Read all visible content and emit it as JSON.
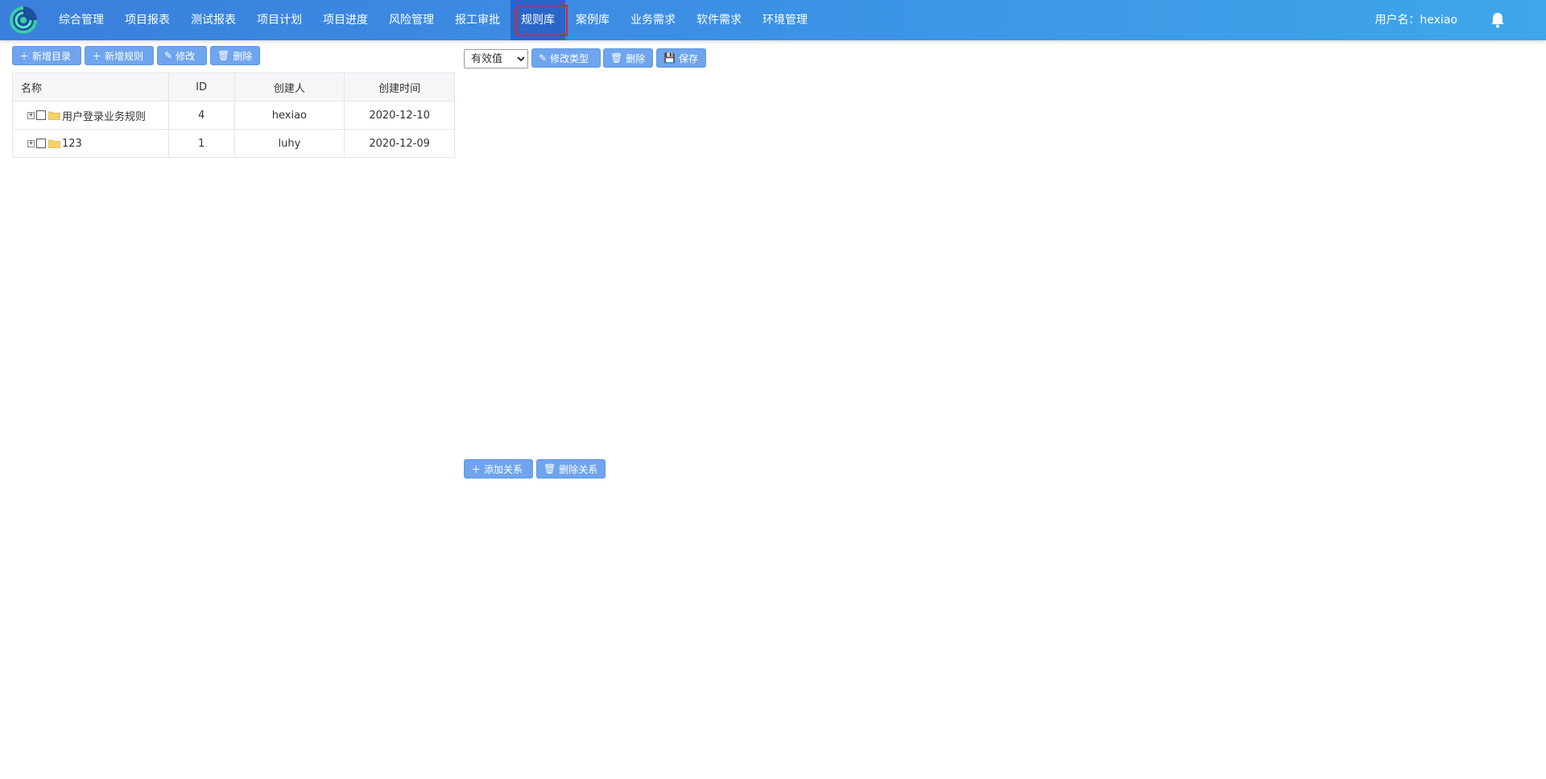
{
  "nav": {
    "items": [
      {
        "label": "综合管理"
      },
      {
        "label": "项目报表"
      },
      {
        "label": "测试报表"
      },
      {
        "label": "项目计划"
      },
      {
        "label": "项目进度"
      },
      {
        "label": "风险管理"
      },
      {
        "label": "报工审批"
      },
      {
        "label": "规则库",
        "active": true
      },
      {
        "label": "案例库"
      },
      {
        "label": "业务需求"
      },
      {
        "label": "软件需求"
      },
      {
        "label": "环境管理"
      }
    ],
    "user_label": "用户名：hexiao",
    "bell_icon": "bell-icon"
  },
  "left_toolbar": {
    "add_dir": "新增目录",
    "add_rule": "新增规则",
    "edit": "修改",
    "delete": "删除"
  },
  "table": {
    "headers": [
      "名称",
      "ID",
      "创建人",
      "创建时间"
    ],
    "rows": [
      {
        "name": "用户登录业务规则",
        "id": "4",
        "creator": "hexiao",
        "created": "2020-12-10"
      },
      {
        "name": "123",
        "id": "1",
        "creator": "luhy",
        "created": "2020-12-09"
      }
    ]
  },
  "right_toolbar": {
    "select_value": "有效值",
    "edit_type": "修改类型",
    "delete": "删除",
    "save": "保存"
  },
  "relation_toolbar": {
    "add_relation": "添加关系",
    "delete_relation": "删除关系"
  },
  "colors": {
    "topbar": "#3c8fe4",
    "active_nav": "#2a65c8",
    "highlight_box": "#e0252c",
    "button": "#6fa5ee"
  }
}
